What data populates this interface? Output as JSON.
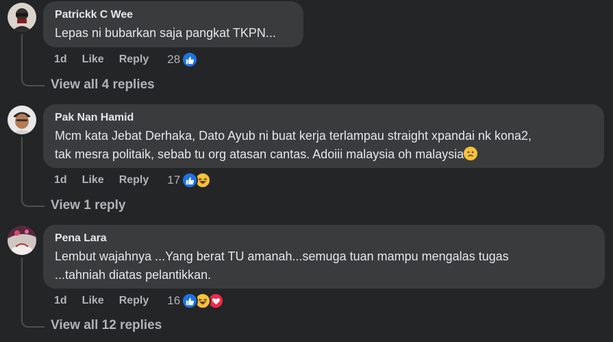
{
  "comments": [
    {
      "author": "Patrickk C Wee",
      "text_lines": [
        "Lepas ni bubarkan saja pangkat TKPN..."
      ],
      "time": "1d",
      "like_label": "Like",
      "reply_label": "Reply",
      "reaction_count": "28",
      "reactions": [
        "like"
      ],
      "view_replies": "View all 4 replies"
    },
    {
      "author": "Pak Nan Hamid",
      "text_lines": [
        "Mcm kata Jebat Derhaka, Dato Ayub ni buat kerja terlampau straight xpandai nk kona2,",
        "tak mesra politaik, sebab tu org atasan cantas. Adoiii malaysia oh malaysia"
      ],
      "time": "1d",
      "like_label": "Like",
      "reply_label": "Reply",
      "reaction_count": "17",
      "reactions": [
        "like",
        "haha"
      ],
      "view_replies": "View 1 reply"
    },
    {
      "author": "Pena Lara",
      "text_lines": [
        "Lembut wajahnya ...Yang berat TU amanah...semuga tuan mampu mengalas tugas",
        "...tahniah diatas pelantikkan."
      ],
      "time": "1d",
      "like_label": "Like",
      "reply_label": "Reply",
      "reaction_count": "16",
      "reactions": [
        "like",
        "haha",
        "love"
      ],
      "view_replies": "View all 12 replies"
    }
  ],
  "colors": {
    "background": "#242526",
    "bubble": "#3a3b3c",
    "meta_text": "#b0b3b8",
    "like_blue": "#1b74e4",
    "haha_yellow": "#f7c23a",
    "love_red": "#f0284a"
  },
  "icons": {
    "like": "thumbs-up-icon",
    "haha": "laughing-face-icon",
    "love": "heart-icon",
    "sad_emoji": "sad-face-emoji"
  }
}
